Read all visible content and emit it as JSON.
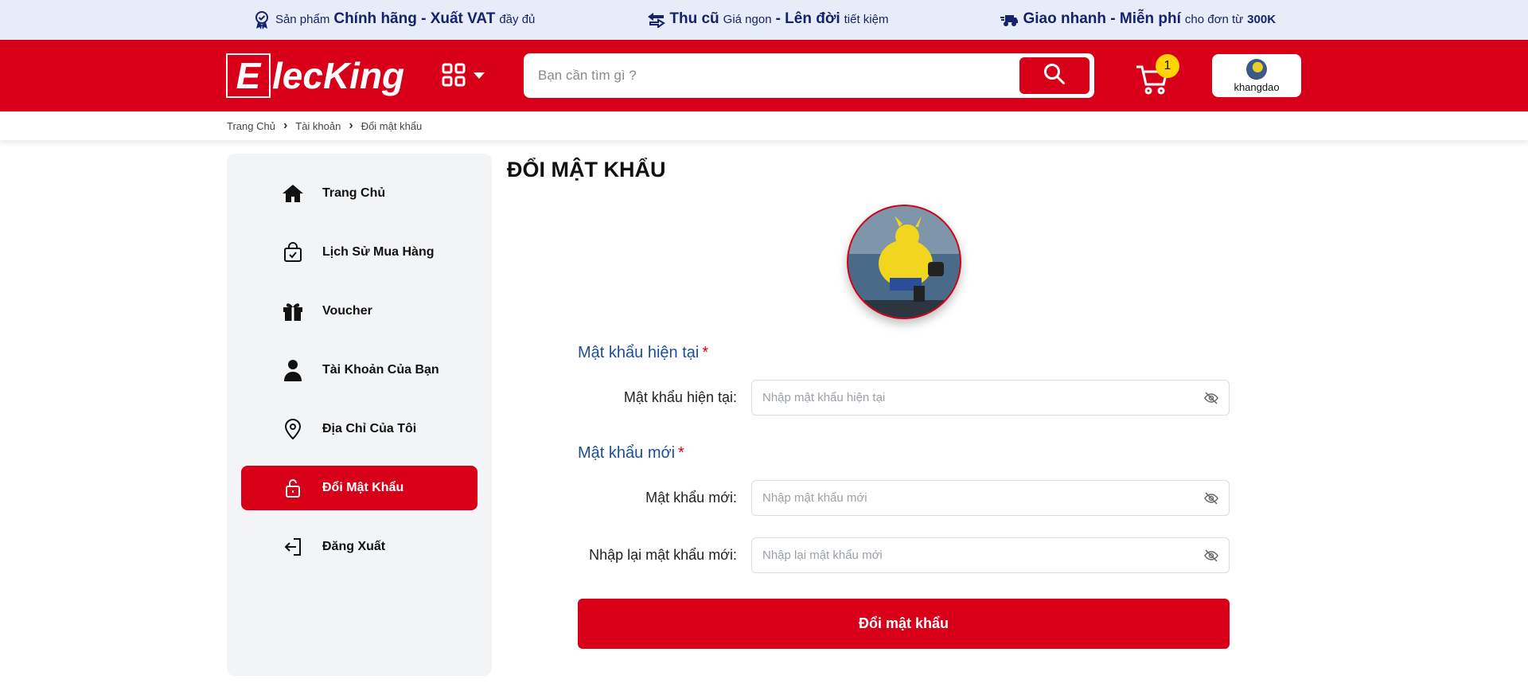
{
  "promo": [
    {
      "icon": "badge-check-icon",
      "parts": [
        {
          "t": "Sản phẩm",
          "b": false
        },
        {
          "t": "Chính hãng - Xuất VAT",
          "b": true
        },
        {
          "t": "đầy đủ",
          "b": false
        }
      ]
    },
    {
      "icon": "exchange-icon",
      "parts": [
        {
          "t": "Thu cũ",
          "b": true
        },
        {
          "t": "Giá ngon",
          "b": false
        },
        {
          "t": "- Lên đời",
          "b": true
        },
        {
          "t": "tiết kiệm",
          "b": false
        }
      ]
    },
    {
      "icon": "delivery-icon",
      "parts": [
        {
          "t": "Giao nhanh - Miễn phí",
          "b": true
        },
        {
          "t": "cho đơn từ",
          "b": false
        },
        {
          "t": "300K",
          "b": true
        }
      ]
    }
  ],
  "header": {
    "logo_first": "E",
    "logo_rest": "lecKing",
    "search_placeholder": "Bạn cần tìm gì ?",
    "cart_count": "1",
    "username": "khangdao"
  },
  "breadcrumb": [
    "Trang Chủ",
    "Tài khoản",
    "Đổi mật khẩu"
  ],
  "sidebar": [
    {
      "label": "Trang Chủ",
      "icon": "home-icon",
      "active": false
    },
    {
      "label": "Lịch Sử Mua Hàng",
      "icon": "shopping-bag-check-icon",
      "active": false
    },
    {
      "label": "Voucher",
      "icon": "gift-icon",
      "active": false
    },
    {
      "label": "Tài Khoản Của Bạn",
      "icon": "user-icon",
      "active": false
    },
    {
      "label": "Địa Chỉ Của Tôi",
      "icon": "map-pin-icon",
      "active": false
    },
    {
      "label": "Đổi Mật Khẩu",
      "icon": "lock-icon",
      "active": true
    },
    {
      "label": "Đăng Xuất",
      "icon": "logout-icon",
      "active": false
    }
  ],
  "main": {
    "title": "ĐỔI MẬT KHẨU",
    "section_current": "Mật khẩu hiện tại",
    "section_new": "Mật khẩu mới",
    "required_mark": "*",
    "current_label": "Mật khẩu hiện tại:",
    "current_placeholder": "Nhập mật khẩu hiện tại",
    "new_label": "Mật khẩu mới:",
    "new_placeholder": "Nhập mật khẩu mới",
    "confirm_label": "Nhập lại mật khẩu mới:",
    "confirm_placeholder": "Nhập lại mật khẩu mới",
    "submit_label": "Đổi mật khẩu"
  },
  "colors": {
    "brand_red": "#d70018",
    "promo_bg": "#e6ecf8",
    "promo_text": "#14236b",
    "section_blue": "#1c4e9a",
    "badge_yellow": "#ffd400"
  }
}
